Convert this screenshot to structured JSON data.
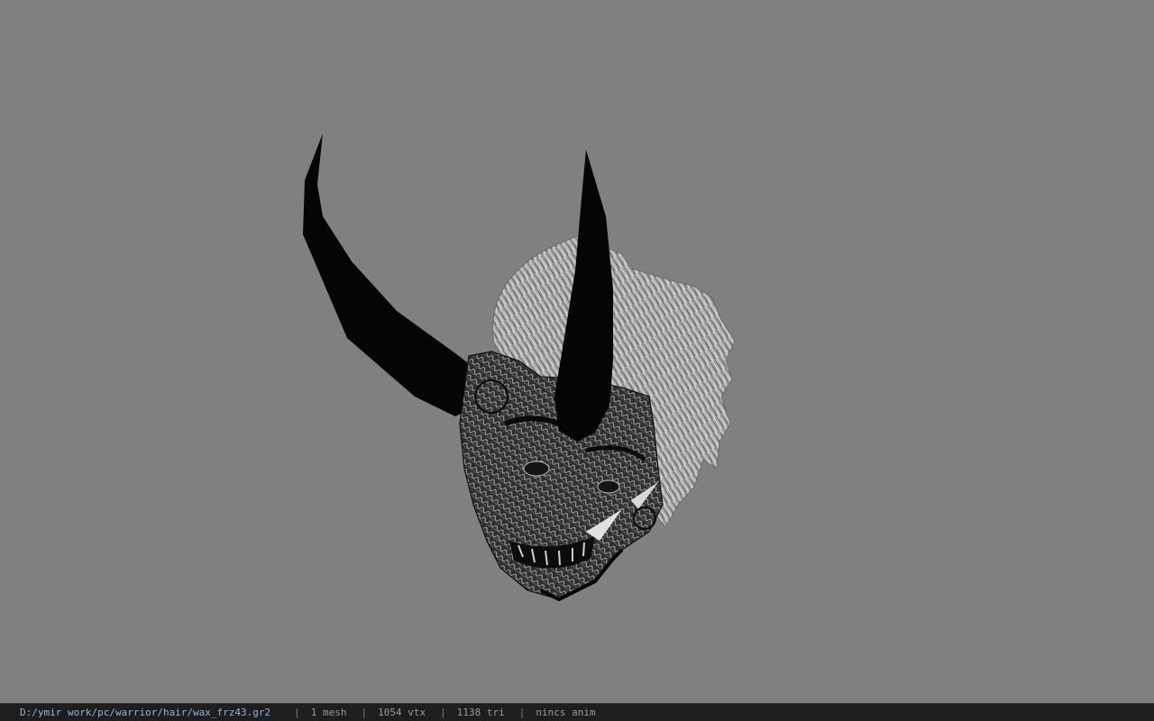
{
  "viewer": {
    "background_color": "#808080",
    "model": {
      "description_icon": "oni-mask-helmet-model",
      "mesh_colors": {
        "horn": "#050505",
        "hair_light": "#d0d0d0",
        "hair_dark": "#6a6a6a",
        "mask": "#2a2a2a"
      }
    }
  },
  "status_bar": {
    "file_path": "D:/ymir work/pc/warrior/hair/wax_frz43.gr2",
    "separator": "|",
    "mesh_count": "1 mesh",
    "vertex_count": "1054 vtx",
    "triangle_count": "1138 tri",
    "anim_status": "nincs anim"
  }
}
